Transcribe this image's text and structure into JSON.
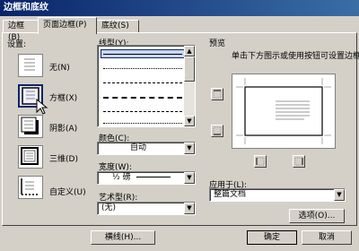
{
  "window": {
    "title": "边框和底纹"
  },
  "tabs": [
    {
      "label": "边框(B)"
    },
    {
      "label": "页面边框(P)"
    },
    {
      "label": "底纹(S)"
    }
  ],
  "settings": {
    "title": "设置:",
    "items": [
      {
        "label": "无(N)",
        "icon": "setting-none-icon"
      },
      {
        "label": "方框(X)",
        "icon": "setting-box-icon",
        "selected": true
      },
      {
        "label": "阴影(A)",
        "icon": "setting-shadow-icon"
      },
      {
        "label": "三维(D)",
        "icon": "setting-3d-icon"
      },
      {
        "label": "自定义(U)",
        "icon": "setting-custom-icon"
      }
    ]
  },
  "style": {
    "title": "线型(Y):",
    "color_label": "颜色(C):",
    "color_value": "自动",
    "width_label": "宽度(W):",
    "width_value": "½ 磅",
    "art_label": "艺术型(R):",
    "art_value": "(无)"
  },
  "preview": {
    "title": "预览",
    "hint": "单击下方图示或使用按钮可设置边框",
    "apply_label": "应用于(L):",
    "apply_value": "整篇文档",
    "options_button": "选项(O)..."
  },
  "footer": {
    "hline_button": "横线(H)...",
    "ok_button": "确定",
    "cancel_button": "取消"
  }
}
